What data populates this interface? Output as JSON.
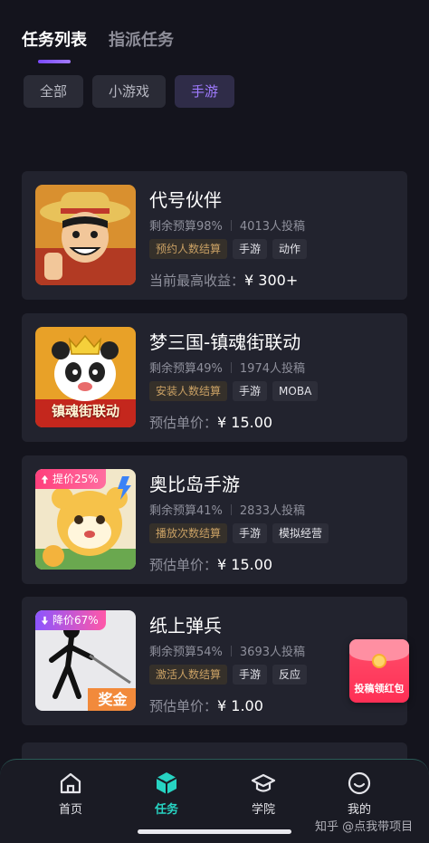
{
  "top_tabs": [
    {
      "label": "任务列表",
      "active": true
    },
    {
      "label": "指派任务",
      "active": false
    }
  ],
  "filters": [
    {
      "label": "全部",
      "active": false
    },
    {
      "label": "小游戏",
      "active": false
    },
    {
      "label": "手游",
      "active": true
    }
  ],
  "cards": [
    {
      "title": "代号伙伴",
      "budget": "剩余预算98%",
      "submissions": "4013人投稿",
      "tags": [
        "预约人数结算",
        "手游",
        "动作"
      ],
      "price_label": "当前最高收益：",
      "price_value": "¥ 300+",
      "badge": ""
    },
    {
      "title": "梦三国-镇魂街联动",
      "budget": "剩余预算49%",
      "submissions": "1974人投稿",
      "tags": [
        "安装人数结算",
        "手游",
        "MOBA"
      ],
      "price_label": "预估单价：",
      "price_value": "¥ 15.00",
      "badge": "",
      "thumb_caption": "镇魂街联动"
    },
    {
      "title": "奥比岛手游",
      "budget": "剩余预算41%",
      "submissions": "2833人投稿",
      "tags": [
        "播放次数结算",
        "手游",
        "模拟经营"
      ],
      "price_label": "预估单价：",
      "price_value": "¥ 15.00",
      "badge": "提价25%"
    },
    {
      "title": "纸上弹兵",
      "budget": "剩余预算54%",
      "submissions": "3693人投稿",
      "tags": [
        "激活人数结算",
        "手游",
        "反应"
      ],
      "price_label": "预估单价：",
      "price_value": "¥ 1.00",
      "badge": "降价67%",
      "thumb_caption": "奖金"
    }
  ],
  "red_packet": {
    "label": "投稿领红包"
  },
  "bottom_nav": [
    {
      "label": "首页",
      "icon": "home-icon",
      "active": false
    },
    {
      "label": "任务",
      "icon": "cube-icon",
      "active": true
    },
    {
      "label": "学院",
      "icon": "graduation-cap-icon",
      "active": false
    },
    {
      "label": "我的",
      "icon": "smile-icon",
      "active": false
    }
  ],
  "watermark": "知乎 @点我带项目",
  "colors": {
    "background": "#14141d",
    "card": "#22232e",
    "accent_purple": "#a07bff",
    "accent_teal": "#27d3c2",
    "gold_tag": "#c9a064"
  }
}
